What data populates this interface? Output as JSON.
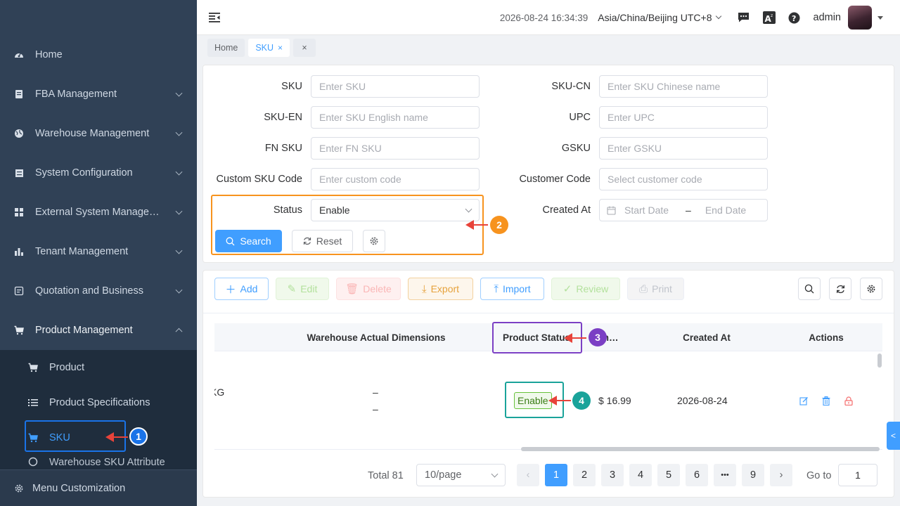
{
  "sidebar": {
    "items": [
      {
        "label": "Home",
        "icon": "dashboard-icon"
      },
      {
        "label": "FBA Management",
        "icon": "document-icon"
      },
      {
        "label": "Warehouse Management",
        "icon": "globe-icon"
      },
      {
        "label": "System Configuration",
        "icon": "server-icon"
      },
      {
        "label": "External System Manage…",
        "icon": "grid-icon"
      },
      {
        "label": "Tenant Management",
        "icon": "bar-chart-icon"
      },
      {
        "label": "Quotation and Business",
        "icon": "quotation-icon"
      },
      {
        "label": "Product Management",
        "icon": "cart-icon"
      }
    ],
    "sub_items": [
      {
        "label": "Product",
        "icon": "cart-icon"
      },
      {
        "label": "Product Specifications",
        "icon": "list-icon"
      },
      {
        "label": "SKU",
        "icon": "cart-icon"
      },
      {
        "label": "Warehouse SKU Attribute",
        "icon": "attribute-icon"
      }
    ],
    "footer_label": "Menu Customization"
  },
  "header": {
    "datetime": "2026-08-24 16:34:39",
    "timezone": "Asia/China/Beijing UTC+8",
    "username": "admin"
  },
  "tags": [
    {
      "label": "Home"
    },
    {
      "label": "SKU",
      "close": "×"
    },
    {
      "close": "×"
    }
  ],
  "search": {
    "sku": {
      "label": "SKU",
      "placeholder": "Enter SKU"
    },
    "sku_cn": {
      "label": "SKU-CN",
      "placeholder": "Enter SKU Chinese name"
    },
    "sku_en": {
      "label": "SKU-EN",
      "placeholder": "Enter SKU English name"
    },
    "upc": {
      "label": "UPC",
      "placeholder": "Enter UPC"
    },
    "fn_sku": {
      "label": "FN SKU",
      "placeholder": "Enter FN SKU"
    },
    "gsku": {
      "label": "GSKU",
      "placeholder": "Enter GSKU"
    },
    "custom_code": {
      "label": "Custom SKU Code",
      "placeholder": "Enter custom code"
    },
    "customer_code": {
      "label": "Customer Code",
      "placeholder": "Select customer code"
    },
    "status": {
      "label": "Status",
      "value": "Enable"
    },
    "created_at": {
      "label": "Created At",
      "start": "Start Date",
      "sep": "–",
      "end": "End Date"
    },
    "search_label": "Search",
    "reset_label": "Reset"
  },
  "annotations": [
    "1",
    "2",
    "3",
    "4"
  ],
  "annotation_colors": {
    "blue": "#1a73e8",
    "orange": "#f7931e",
    "purple": "#7b3fc4",
    "teal": "#1aa39a",
    "red": "#e8433a"
  },
  "toolbar": {
    "add": "Add",
    "edit": "Edit",
    "delete": "Delete",
    "export": "Export",
    "import": "Import",
    "review": "Review",
    "print": "Print"
  },
  "table": {
    "columns": [
      "Warehouse Actual Dimensions",
      "Product Status",
      "rch…",
      "Created At",
      "Actions"
    ],
    "rows": [
      {
        "left_fragment": "KG",
        "dim_1": "–",
        "dim_2": "–",
        "status": "Enable",
        "price": "$ 16.99",
        "created_at": "2026-08-24"
      }
    ]
  },
  "pager": {
    "total": "Total 81",
    "page_size": "10/page",
    "prev": "‹",
    "next": "›",
    "pages": [
      "1",
      "2",
      "3",
      "4",
      "5",
      "6",
      "•••",
      "9"
    ],
    "goto_label": "Go to",
    "goto_value": "1"
  },
  "side_tab": "<"
}
